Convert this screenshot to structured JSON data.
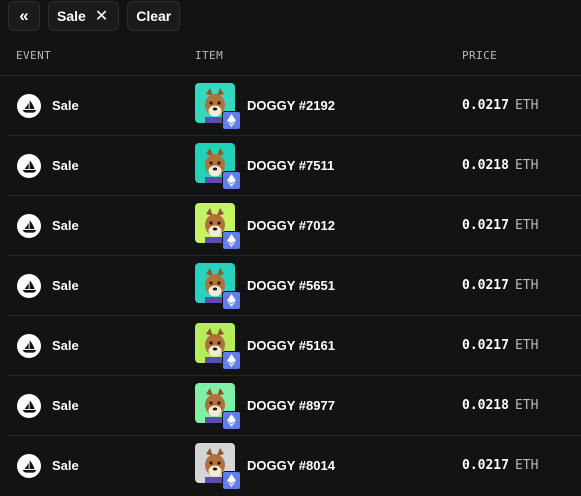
{
  "filters": {
    "collapse_label": "«",
    "chips": [
      {
        "label": "Sale",
        "remove_icon": "close-icon"
      }
    ],
    "clear_label": "Clear"
  },
  "table": {
    "columns": [
      "EVENT",
      "ITEM",
      "PRICE"
    ],
    "rows": [
      {
        "event": "Sale",
        "item": "DOGGY #2192",
        "amount": "0.0217",
        "currency": "ETH",
        "thumb_color": "#35d7bd"
      },
      {
        "event": "Sale",
        "item": "DOGGY #7511",
        "amount": "0.0218",
        "currency": "ETH",
        "thumb_color": "#23d1b6"
      },
      {
        "event": "Sale",
        "item": "DOGGY #7012",
        "amount": "0.0217",
        "currency": "ETH",
        "thumb_color": "#c6f266"
      },
      {
        "event": "Sale",
        "item": "DOGGY #5651",
        "amount": "0.0217",
        "currency": "ETH",
        "thumb_color": "#28d2bf"
      },
      {
        "event": "Sale",
        "item": "DOGGY #5161",
        "amount": "0.0217",
        "currency": "ETH",
        "thumb_color": "#b4ec5e"
      },
      {
        "event": "Sale",
        "item": "DOGGY #8977",
        "amount": "0.0218",
        "currency": "ETH",
        "thumb_color": "#7ff0a6"
      },
      {
        "event": "Sale",
        "item": "DOGGY #8014",
        "amount": "0.0217",
        "currency": "ETH",
        "thumb_color": "#d5d5d5"
      }
    ]
  },
  "icons": {
    "event": "opensea-boat-icon",
    "chain": "ethereum-icon"
  },
  "colors": {
    "background": "#131313",
    "eth_badge": "#627eea",
    "divider": "#262626"
  }
}
